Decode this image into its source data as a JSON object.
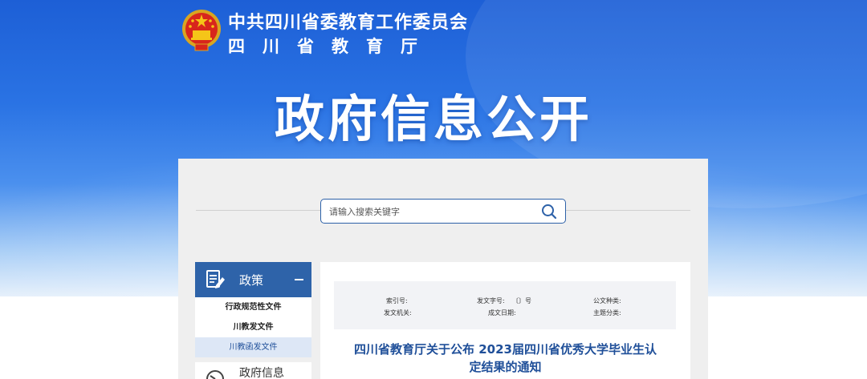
{
  "header": {
    "org_line1": "中共四川省委教育工作委员会",
    "org_line2": "四川省教育厅",
    "hero_title": "政府信息公开"
  },
  "search": {
    "placeholder": "请输入搜索关键字"
  },
  "sidebar": {
    "section1": {
      "label": "政策",
      "items": [
        "行政规范性文件",
        "川教发文件",
        "川教函发文件"
      ]
    },
    "section2": {
      "label": "政府信息"
    }
  },
  "document": {
    "meta": {
      "index_no_label": "索引号:",
      "doc_no_label": "发文字号:",
      "doc_no_value": "〔〕号",
      "category_label": "公文种类:",
      "issuer_label": "发文机关:",
      "created_label": "成文日期:",
      "topic_label": "主题分类:"
    },
    "title_line1": "四川省教育厅关于公布  2023届四川省优秀大学毕业生认",
    "title_line2": "定结果的通知"
  },
  "colors": {
    "banner_blue": "#1d5fd6",
    "nav_blue": "#2e63a9",
    "title_blue": "#1f4f99"
  }
}
